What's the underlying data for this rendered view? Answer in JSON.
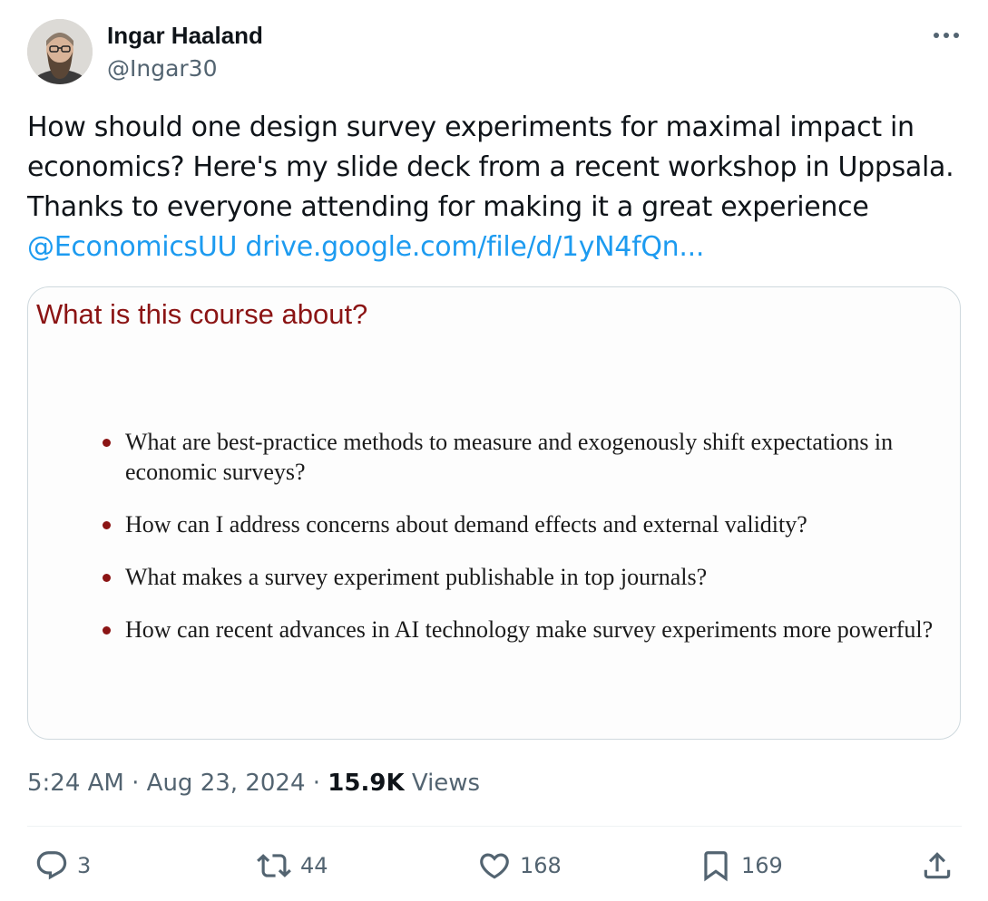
{
  "author": {
    "name": "Ingar Haaland",
    "handle": "@Ingar30"
  },
  "tweet": {
    "line1": "How should one design survey experiments for maximal impact in",
    "line2": "economics? Here's my slide deck from a recent workshop in Uppsala.",
    "line3": "Thanks to everyone attending for making it a great experience",
    "mention": "@EconomicsUU",
    "link": "drive.google.com/file/d/1yN4fQn..."
  },
  "slide": {
    "title": "What is this course about?",
    "bullets": [
      "What are best-practice methods to measure and exogenously shift expectations in economic surveys?",
      "How can I address concerns about demand effects and external validity?",
      "What makes a survey experiment publishable in top journals?",
      "How can recent advances in AI technology make survey experiments more powerful?"
    ]
  },
  "meta": {
    "time": "5:24 AM",
    "date": "Aug 23, 2024",
    "separator": "·",
    "views_count": "15.9K",
    "views_label": "Views"
  },
  "actions": {
    "replies": "3",
    "reposts": "44",
    "likes": "168",
    "bookmarks": "169"
  },
  "icons": {
    "more": "more-horizontal-icon",
    "reply": "reply-icon",
    "repost": "repost-icon",
    "like": "heart-icon",
    "bookmark": "bookmark-icon",
    "share": "share-icon"
  },
  "colors": {
    "link": "#1d9bf0",
    "slide_accent": "#8b1414",
    "secondary_text": "#536471"
  }
}
